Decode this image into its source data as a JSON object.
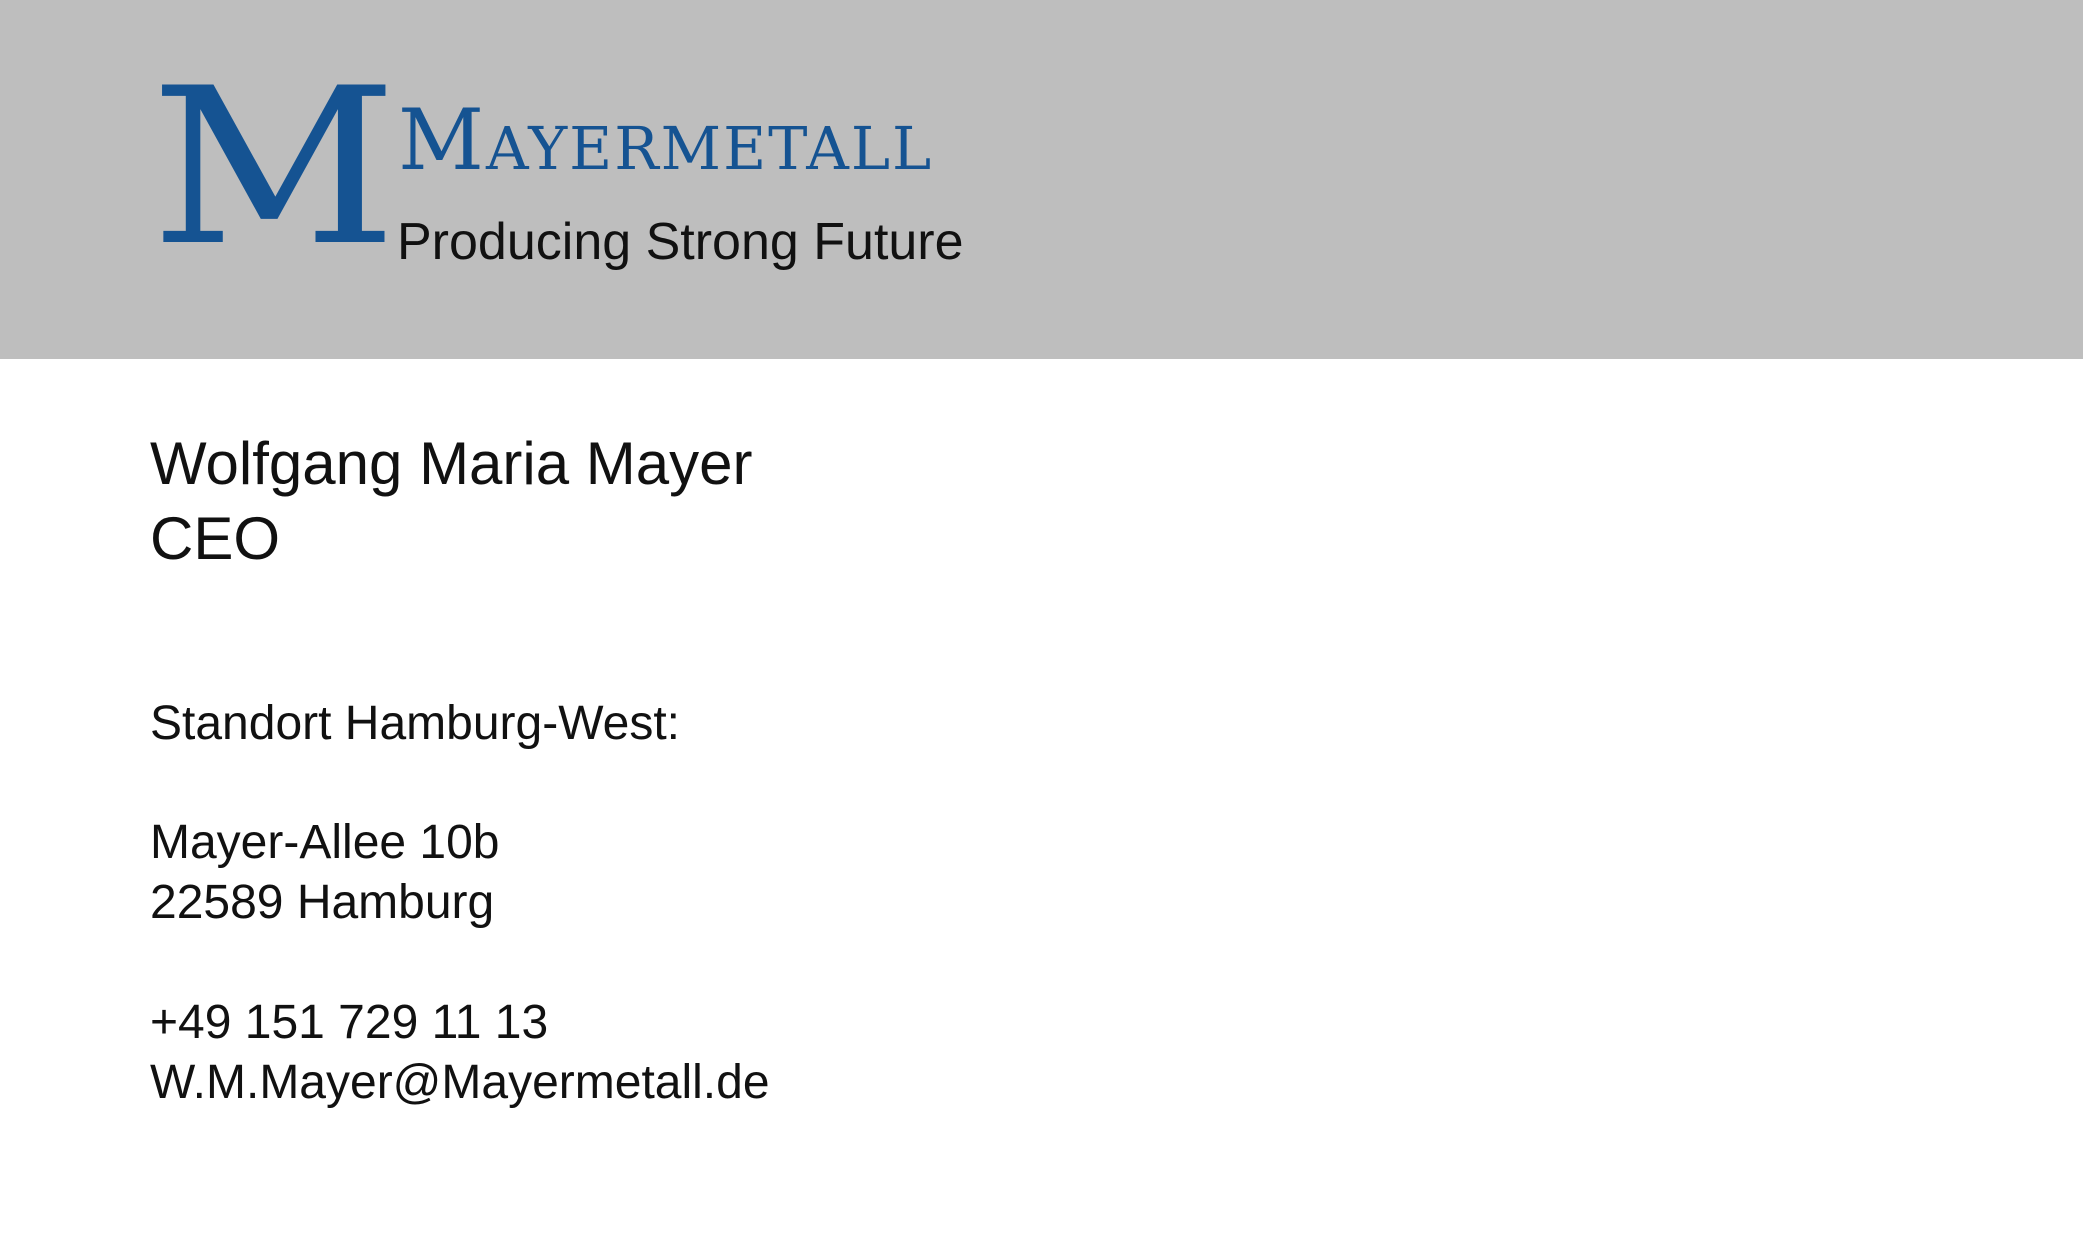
{
  "logo": {
    "mark": "M",
    "company_name": "Mayermetall",
    "tagline": "Producing Strong Future"
  },
  "contact": {
    "name": "Wolfgang Maria Mayer",
    "role": "CEO",
    "location_label": "Standort Hamburg-West:",
    "street": "Mayer-Allee 10b",
    "city": "22589 Hamburg",
    "phone": "+49 151 729 11 13",
    "email": "W.M.Mayer@Mayermetall.de"
  },
  "colors": {
    "brand_blue": "#155392",
    "header_gray": "#bebebe",
    "text": "#111111"
  }
}
